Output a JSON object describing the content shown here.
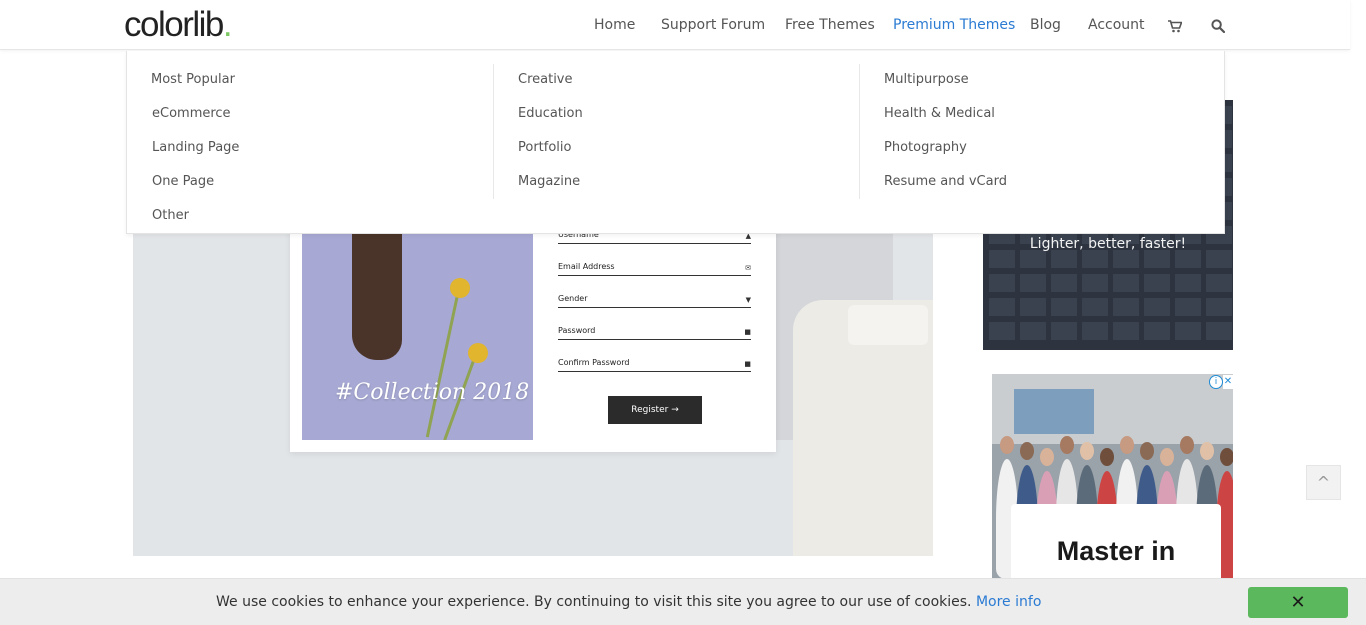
{
  "brand": {
    "logo_text": "colorlib",
    "logo_dot": "."
  },
  "nav": {
    "items": [
      {
        "label": "Home"
      },
      {
        "label": "Support Forum"
      },
      {
        "label": "Free Themes"
      },
      {
        "label": "Premium Themes",
        "active": true
      },
      {
        "label": "Blog"
      },
      {
        "label": "Account"
      }
    ],
    "cart_icon": "cart-icon",
    "search_icon": "search-icon"
  },
  "mega_menu": {
    "columns": [
      {
        "items": [
          "Most Popular",
          "eCommerce",
          "Landing Page",
          "One Page",
          "Other"
        ]
      },
      {
        "items": [
          "Creative",
          "Education",
          "Portfolio",
          "Magazine"
        ]
      },
      {
        "items": [
          "Multipurpose",
          "Health & Medical",
          "Photography",
          "Resume and vCard"
        ]
      }
    ]
  },
  "hero": {
    "collection_text": "#Collection 2018",
    "form": {
      "fields": [
        {
          "label": "Username",
          "icon": "user-icon"
        },
        {
          "label": "Email Address",
          "icon": "envelope-icon"
        },
        {
          "label": "Gender",
          "icon": "caret-down-icon"
        },
        {
          "label": "Password",
          "icon": "lock-icon"
        },
        {
          "label": "Confirm Password",
          "icon": "lock-icon"
        }
      ],
      "register_label": "Register",
      "register_arrow": "→"
    }
  },
  "sidebar": {
    "ad1_text": "Lighter, better, faster!",
    "ad2_title": "Master in",
    "ad2_info": "i",
    "ad2_close": "✕"
  },
  "scroll_top_icon": "chevron-up-icon",
  "cookie_bar": {
    "text": "We use cookies to enhance your experience. By continuing to visit this site you agree to our use of cookies.",
    "link": "More info",
    "close_label": "✕"
  },
  "colors": {
    "accent_blue": "#2b7bd3",
    "logo_dot_green": "#7bc862",
    "cookie_close_green": "#5cb85c"
  }
}
